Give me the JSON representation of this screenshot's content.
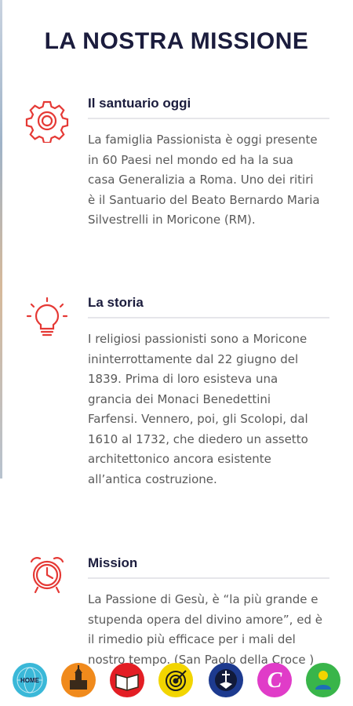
{
  "page": {
    "title": "LA NOSTRA MISSIONE"
  },
  "sections": [
    {
      "icon": "gear-icon",
      "title": "Il santuario oggi",
      "body": "La famiglia Passionista è oggi presente in 60 Paesi nel mondo ed ha la sua casa Generalizia a Roma. Uno dei ritiri è il Santuario del Beato Bernardo Maria Silvestrelli in Moricone (RM)."
    },
    {
      "icon": "lightbulb-icon",
      "title": "La storia",
      "body": "I religiosi passionisti sono a Moricone ininterrottamente dal 22 giugno del 1839. Prima di loro esisteva una grancia dei Monaci Benedettini Farfensi. Vennero, poi, gli Scolopi, dal 1610 al 1732, che diedero un assetto architettonico ancora esistente all’antica costruzione."
    },
    {
      "icon": "alarm-clock-icon",
      "title": "Mission",
      "body": "La Passione di Gesù, è “la più grande e stupenda opera del divino amore”, ed è il rimedio più efficace per i mali del nostro tempo. (San Paolo della Croce )"
    }
  ],
  "bottom_nav": [
    {
      "icon": "home-globe-icon",
      "label": "HOME",
      "color": "#3ab8d8"
    },
    {
      "icon": "church-icon",
      "color": "#f08a1c"
    },
    {
      "icon": "book-icon",
      "color": "#e31e24"
    },
    {
      "icon": "target-icon",
      "color": "#f2d500"
    },
    {
      "icon": "passionist-emblem-icon",
      "color": "#1d3a8f"
    },
    {
      "icon": "letter-c-icon",
      "color": "#e03cc8"
    },
    {
      "icon": "people-icon",
      "color": "#39b54a"
    }
  ],
  "colors": {
    "accent": "#e53935",
    "heading": "#1b1c3d",
    "body_text": "#5a5a5a"
  }
}
